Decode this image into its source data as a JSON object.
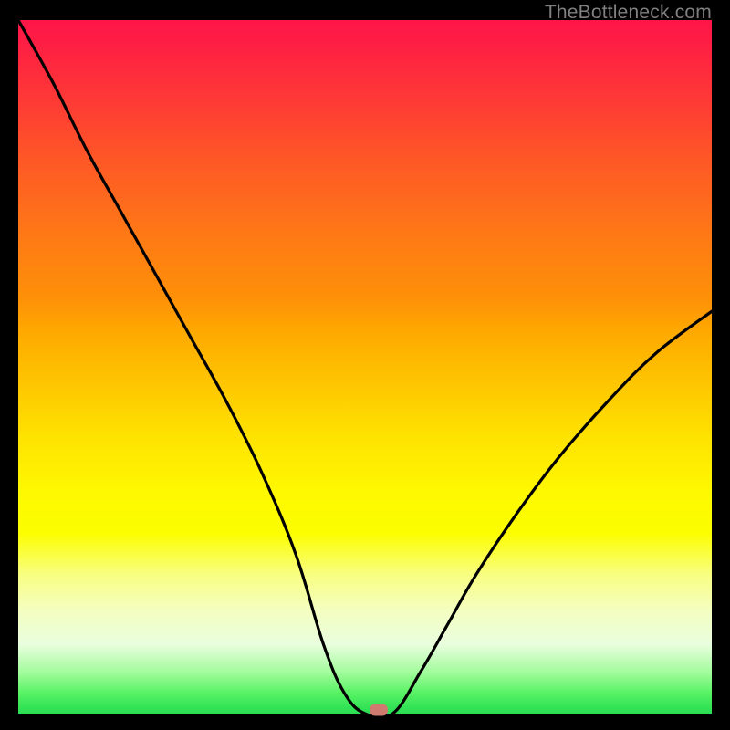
{
  "watermark": "TheBottleneck.com",
  "chart_data": {
    "type": "line",
    "title": "",
    "xlabel": "",
    "ylabel": "",
    "xlim": [
      0,
      100
    ],
    "ylim": [
      0,
      100
    ],
    "grid": false,
    "series": [
      {
        "name": "bottleneck-curve",
        "x": [
          0,
          5,
          10,
          15,
          20,
          25,
          30,
          35,
          40,
          44,
          47,
          50,
          54,
          58,
          62,
          66,
          72,
          78,
          85,
          92,
          100
        ],
        "y": [
          100,
          91,
          81,
          72,
          63,
          54,
          45,
          35,
          23,
          10,
          3,
          0,
          0,
          6,
          13,
          20,
          29,
          37,
          45,
          52,
          58
        ]
      }
    ],
    "marker": {
      "x": 52,
      "y": 0.5,
      "color": "#cf7b6f"
    },
    "background_gradient": {
      "top": "#fe1548",
      "mid": "#fee200",
      "bottom": "#2cde54"
    }
  }
}
